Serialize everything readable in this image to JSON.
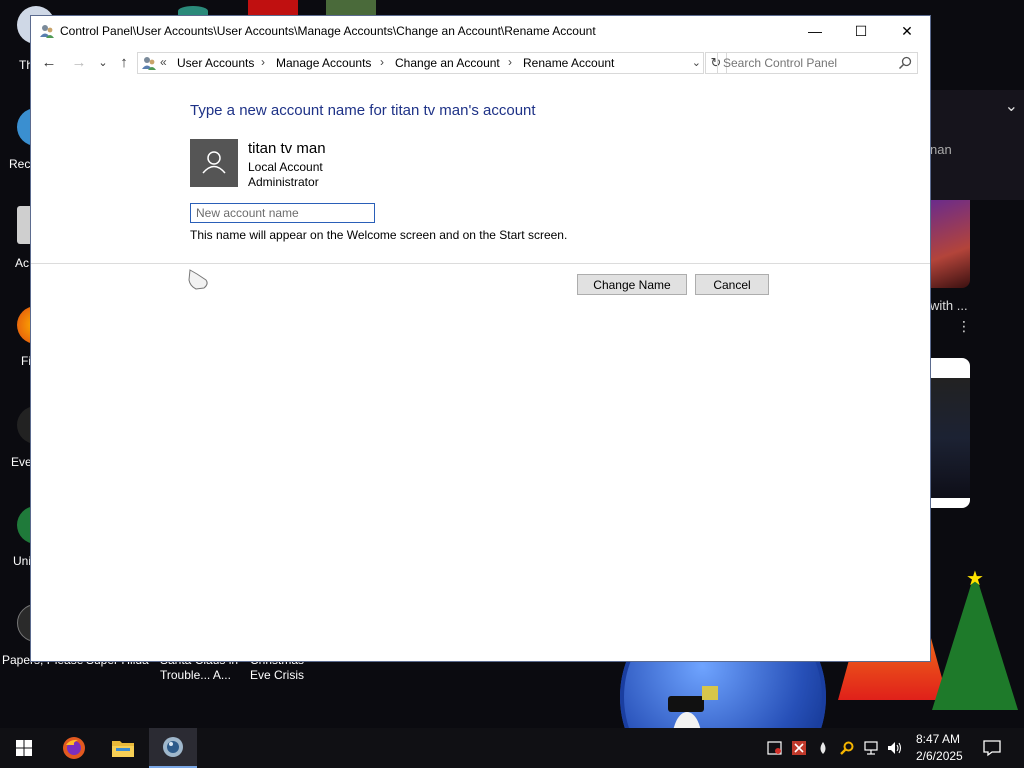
{
  "desktop": {
    "icon_labels": [
      "Th",
      "Recy",
      "Ac",
      "Fi",
      "Ever",
      "Uni",
      "Papers, Please",
      "Super Hilda",
      "Santa Claus in Trouble... A...",
      "Christmas Eve Crisis"
    ],
    "right_panel_text": "nan",
    "with_text": "with ...",
    "dots": "⋮"
  },
  "window": {
    "title": "Control Panel\\User Accounts\\User Accounts\\Manage Accounts\\Change an Account\\Rename Account",
    "controls": {
      "minimize": "—",
      "maximize": "☐",
      "close": "✕"
    }
  },
  "navigation": {
    "back": "←",
    "forward": "→",
    "recent": "⌄",
    "up": "↑",
    "overflow": "«",
    "breadcrumbs": [
      "User Accounts",
      "Manage Accounts",
      "Change an Account",
      "Rename Account"
    ],
    "separator": "›",
    "refresh": "↻",
    "search_placeholder": "Search Control Panel"
  },
  "content": {
    "heading": "Type a new account name for titan tv man's account",
    "account": {
      "name": "titan tv man",
      "type": "Local Account",
      "role": "Administrator"
    },
    "input_placeholder": "New account name",
    "hint": "This name will appear on the Welcome screen and on the Start screen.",
    "change_button": "Change Name",
    "cancel_button": "Cancel"
  },
  "taskbar": {
    "time": "8:47 AM",
    "date": "2/6/2025"
  },
  "colors": {
    "heading_blue": "#1e3287",
    "input_border": "#2a5fb8",
    "button_bg": "#e1e1e1",
    "taskbar_bg": "#101014"
  }
}
